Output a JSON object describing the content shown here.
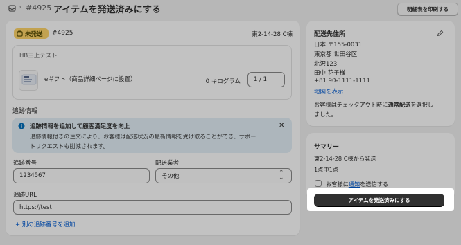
{
  "header": {
    "icon": "orders-icon",
    "separator": "›",
    "order_number": "#4925",
    "title": "アイテムを発送済みにする",
    "print_button": "明細表を印刷する"
  },
  "fulfillment": {
    "status_badge": "未発送",
    "badge_color": "#ffd56a",
    "order_number": "#4925",
    "location": "東2-14-28 C棟",
    "item_group_title": "HB三上テスト",
    "item": {
      "name": "eギフト（商品詳細ページに設置）",
      "weight": "0 キログラム",
      "quantity": "1   / 1"
    },
    "tracking": {
      "section_title": "追跡情報",
      "banner_title": "追跡情報を追加して顧客満足度を向上",
      "banner_text_1": "追跡情報付きの注文により、お客様は配送状況の最新情報を受け取ることができ、サポー",
      "banner_text_2": "トリクエストも削減されます。",
      "number_label": "追跡番号",
      "number_value": "1234567",
      "carrier_label": "配送業者",
      "carrier_value": "その他",
      "url_label": "追跡URL",
      "url_value": "https://test",
      "add_link": "別の追跡番号を追加"
    }
  },
  "shipping_address": {
    "title": "配送先住所",
    "lines": [
      "日本 〒155-0031",
      "東京都 世田谷区",
      "北沢123",
      "田中 花子様",
      "+81 90-1111-1111"
    ],
    "map_link": "地図を表示",
    "note_line1_pre": "お客様はチェックアウト時に",
    "note_line1_bold": "通常配送",
    "note_line1_post": "を選択し",
    "note_line2": "ました。"
  },
  "summary": {
    "title": "サマリー",
    "ship_from": "東2-14-28 C棟から発送",
    "count": "1点中1点",
    "notify_pre": "お客様に",
    "notify_link": "通知",
    "notify_post": "を送信する",
    "primary_button": "アイテムを発送済みにする",
    "accent_color": "#303030"
  }
}
